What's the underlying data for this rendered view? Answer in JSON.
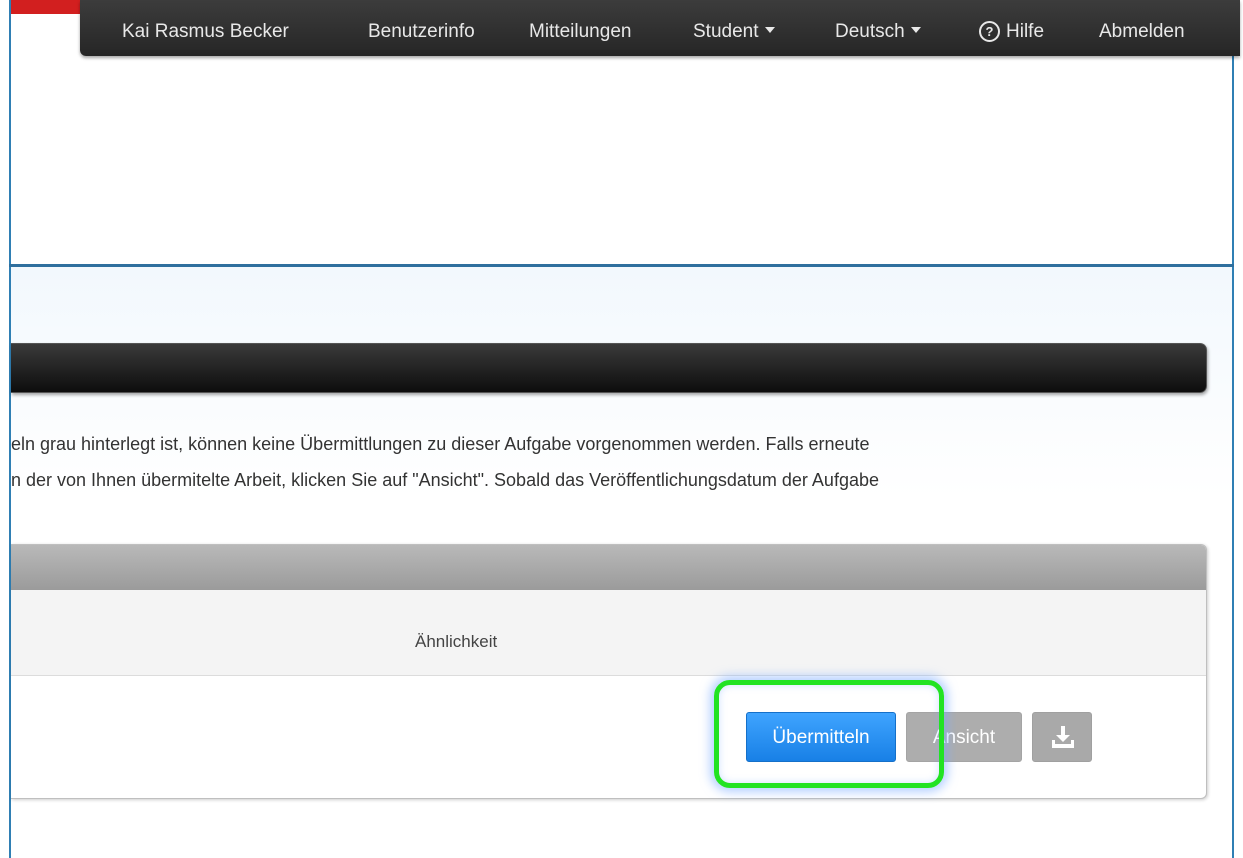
{
  "nav": {
    "user_name": "Kai Rasmus Becker",
    "user_info": "Benutzerinfo",
    "messages": "Mitteilungen",
    "role": "Student",
    "language": "Deutsch",
    "help": "Hilfe",
    "help_symbol": "?",
    "logout": "Abmelden"
  },
  "info": {
    "line1": "eln grau hinterlegt ist, können keine Übermittlungen zu dieser Aufgabe vorgenommen werden. Falls erneute",
    "line2": "n der von Ihnen übermitelte Arbeit, klicken Sie auf \"Ansicht\". Sobald das Veröffentlichungsdatum der Aufgabe"
  },
  "table": {
    "column_similarity": "Ähnlichkeit"
  },
  "actions": {
    "submit_label": "Übermitteln",
    "view_label": "Ansicht"
  },
  "colors": {
    "accent_red": "#d21f1f",
    "primary_blue": "#1880e6",
    "highlight_green": "#22e322",
    "nav_dark": "#262626"
  },
  "icons": {
    "download": "download-icon",
    "help": "help-circle-icon",
    "caret": "caret-down-icon"
  }
}
